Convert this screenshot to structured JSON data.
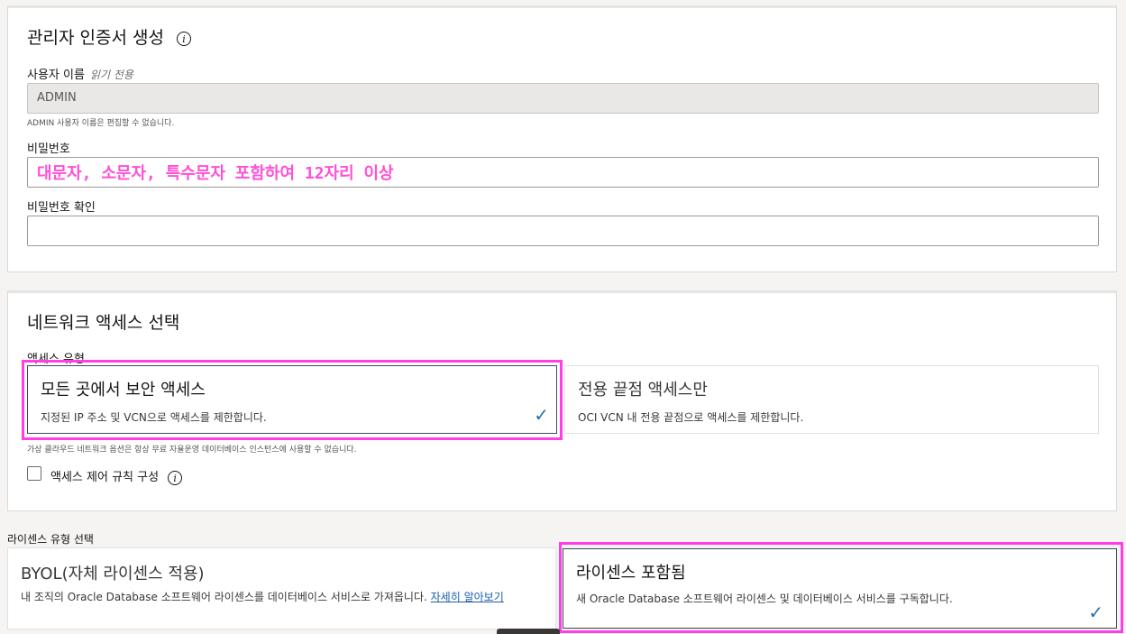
{
  "admin": {
    "title": "관리자 인증서 생성",
    "username_label": "사용자 이름",
    "username_readonly": "읽기 전용",
    "username_value": "ADMIN",
    "username_hint": "ADMIN 사용자 이름은 편집할 수 없습니다.",
    "password_label": "비밀번호",
    "password_annotation": "대문자, 소문자, 특수문자 포함하여 12자리 이상",
    "confirm_label": "비밀번호 확인"
  },
  "network": {
    "title": "네트워크 액세스 선택",
    "access_type_label": "액세스 유형",
    "option1_title": "모든 곳에서 보안 액세스",
    "option1_desc": "지정된 IP 주소 및 VCN으로 액세스를 제한합니다.",
    "option2_title": "전용 끝점 액세스만",
    "option2_desc": "OCI VCN 내 전용 끝점으로 액세스를 제한합니다.",
    "hint": "가상 클라우드 네트워크 옵션은 항상 무료 자율운영 데이터베이스 인스턴스에 사용할 수 없습니다.",
    "acl_label": "액세스 제어 규칙 구성"
  },
  "license": {
    "section_label": "라이센스 유형 선택",
    "byol_title": "BYOL(자체 라이센스 적용)",
    "byol_desc": "내 조직의 Oracle Database 소프트웨어 라이센스를 데이터베이스 서비스로 가져옵니다.",
    "byol_link": "자세히 알아보기",
    "included_title": "라이센스 포함됨",
    "included_desc": "새 Oracle Database 소프트웨어 라이센스 및 데이터베이스 서비스를 구독합니다."
  },
  "icons": {
    "info": "info-icon",
    "check": "checkmark-icon"
  },
  "colors": {
    "highlight": "#ff3ee8",
    "annotation": "#ff4fd8",
    "check": "#2b6fa8",
    "link": "#1a5ea8"
  }
}
